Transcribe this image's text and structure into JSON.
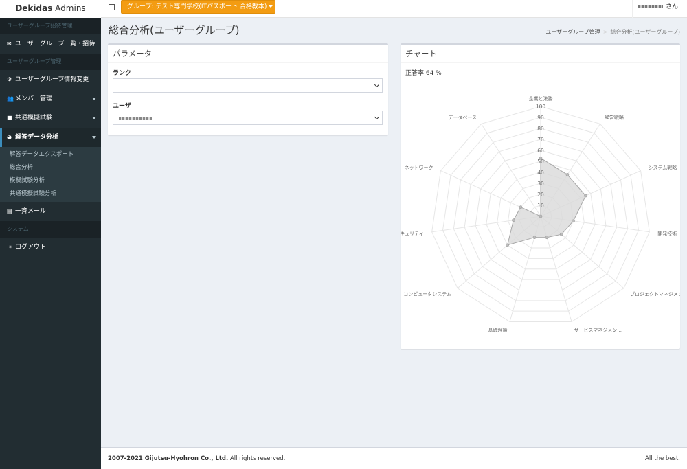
{
  "header": {
    "brand_bold": "Dekidas",
    "brand_rest": " Admins",
    "group_button": "グループ: テスト専門学校(ITパスポート 合格教本)",
    "user_suffix": "さん"
  },
  "sidebar": {
    "section1": "ユーザーグループ招待管理",
    "item_list": "ユーザーグループ一覧・招待",
    "section2": "ユーザーグループ管理",
    "item_info": "ユーザーグループ情報変更",
    "item_members": "メンバー管理",
    "item_common": "共通模擬試験",
    "item_analysis": "解答データ分析",
    "sub_items": [
      "解答データエクスポート",
      "総合分析",
      "模擬試験分析",
      "共通模擬試験分析"
    ],
    "item_mail": "一斉メール",
    "section3": "システム",
    "item_logout": "ログアウト"
  },
  "page": {
    "title": "総合分析(ユーザーグループ)",
    "breadcrumb_home": "ユーザーグループ管理",
    "breadcrumb_sep": ">",
    "breadcrumb_current": "総合分析(ユーザーグループ)"
  },
  "params": {
    "title": "パラメータ",
    "rank_label": "ランク",
    "rank_value": "",
    "user_label": "ユーザ"
  },
  "chart_box": {
    "title": "チャート",
    "rate_label": "正答率 64 %"
  },
  "chart_data": {
    "type": "radar",
    "categories": [
      "企業と法務",
      "経営戦略",
      "システム戦略",
      "開発技術",
      "プロジェクトマネジメント",
      "サービスマネジメン...",
      "基礎理論",
      "コンピュータシステム",
      "セキュリティ",
      "ネットワーク",
      "データベース"
    ],
    "values": [
      53,
      45,
      45,
      30,
      25,
      20,
      20,
      40,
      25,
      20,
      0
    ],
    "ticks": [
      10,
      20,
      30,
      40,
      50,
      60,
      70,
      80,
      90,
      100
    ],
    "rlim": [
      0,
      100
    ],
    "fill_color": "#d9d9d9",
    "line_color": "#a6a6a6"
  },
  "footer": {
    "copyright_bold": "2007-2021 Gijutsu-Hyohron Co., Ltd.",
    "copyright_rest": " All rights reserved.",
    "right": "All the best."
  }
}
